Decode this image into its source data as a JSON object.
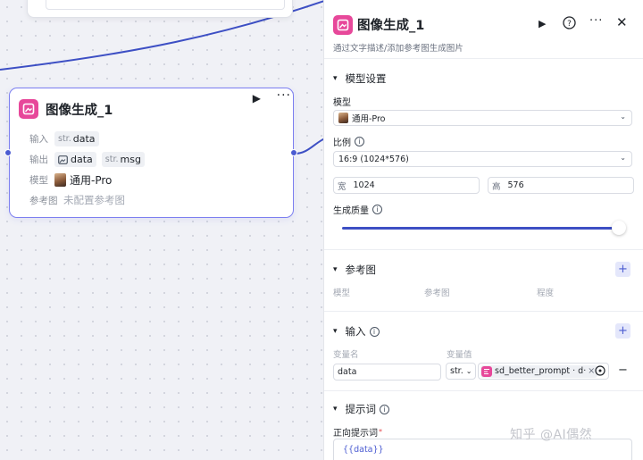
{
  "node": {
    "title": "图像生成_1",
    "input_label": "输入",
    "input_type": "str.",
    "input_value": "data",
    "output_label": "输出",
    "output_value1": "data",
    "output_type2": "str.",
    "output_value2": "msg",
    "model_label": "模型",
    "model_value": "通用-Pro",
    "ref_label": "参考图",
    "ref_value": "未配置参考图"
  },
  "panel": {
    "title": "图像生成_1",
    "description": "通过文字描述/添加参考图生成图片",
    "model_section": "模型设置",
    "model_label": "模型",
    "model_value": "通用-Pro",
    "ratio_label": "比例",
    "ratio_value": "16:9 (1024*576)",
    "width_key": "宽",
    "width_value": "1024",
    "height_key": "高",
    "height_value": "576",
    "quality_label": "生成质量",
    "quality_level": 1.0,
    "ref_section": "参考图",
    "ref_col_model": "模型",
    "ref_col_image": "参考图",
    "ref_col_degree": "程度",
    "input_section": "输入",
    "var_name_head": "变量名",
    "var_value_head": "变量值",
    "var_name": "data",
    "var_type": "str.",
    "var_ref": "sd_better_prompt · d·",
    "prompt_section": "提示词",
    "positive_prompt_label": "正向提示词",
    "positive_prompt_value": "{{data}}"
  },
  "watermark": "知乎 @AI偶然",
  "colors": {
    "accent": "#4a5bd1",
    "app_icon": "#e7489a",
    "node_border": "#7c7ff0"
  }
}
